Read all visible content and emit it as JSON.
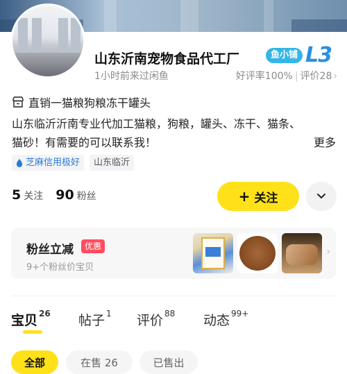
{
  "header": {
    "shop_name": "山东沂南宠物食品代工厂",
    "level_tag": "鱼小铺",
    "level": "L3",
    "active_time": "1小时前来过闲鱼",
    "rating": "好评率100%",
    "review_count": "评价28"
  },
  "intro": {
    "headline": "直销一猫粮狗粮冻干罐头",
    "description": "山东临沂沂南专业代加工猫粮，狗粮，罐头、冻干、猫条、猫砂！有需要的可以联系我！",
    "more_label": "更多"
  },
  "tags": {
    "credit": "芝麻信用极好",
    "location": "山东临沂"
  },
  "stats": {
    "following_count": "5",
    "following_label": "关注",
    "fans_count": "90",
    "fans_label": "粉丝"
  },
  "actions": {
    "follow_label": "关注"
  },
  "fans_card": {
    "title": "粉丝立减",
    "badge": "优惠",
    "subtitle": "9+个粉丝价宝贝"
  },
  "tabs": [
    {
      "label": "宝贝",
      "count": "26"
    },
    {
      "label": "帖子",
      "count": "1"
    },
    {
      "label": "评价",
      "count": "88"
    },
    {
      "label": "动态",
      "count": "99+"
    }
  ],
  "filters": [
    {
      "label": "全部"
    },
    {
      "label": "在售 26"
    },
    {
      "label": "已售出"
    }
  ],
  "colors": {
    "accent_yellow": "#ffe11a",
    "level_blue": "#2a8fe0",
    "badge_red": "#ff4d5e",
    "credit_blue": "#2a7ad8"
  }
}
